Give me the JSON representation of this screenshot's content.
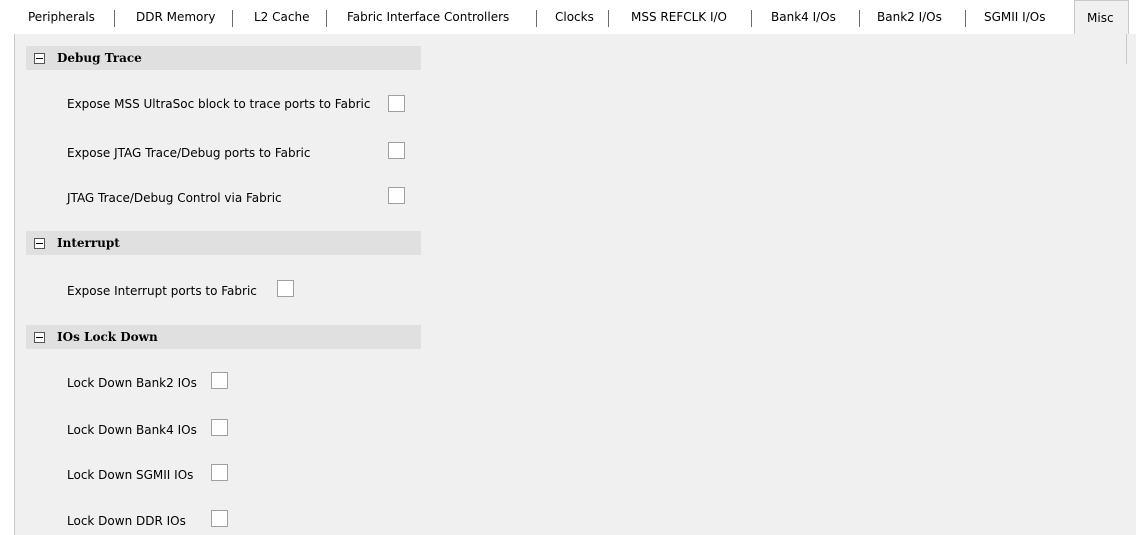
{
  "tabs": [
    {
      "label": "Peripherals"
    },
    {
      "label": "DDR Memory"
    },
    {
      "label": "L2 Cache"
    },
    {
      "label": "Fabric Interface Controllers"
    },
    {
      "label": "Clocks"
    },
    {
      "label": "MSS REFCLK I/O"
    },
    {
      "label": "Bank4 I/Os"
    },
    {
      "label": "Bank2 I/Os"
    },
    {
      "label": "SGMII I/Os"
    },
    {
      "label": "Misc"
    }
  ],
  "active_tab": "Misc",
  "sections": [
    {
      "title": "Debug Trace",
      "options": [
        {
          "label": "Expose MSS UltraSoc block to trace ports to Fabric",
          "checked": false
        },
        {
          "label": "Expose JTAG Trace/Debug ports to Fabric",
          "checked": false
        },
        {
          "label": "JTAG Trace/Debug Control via Fabric",
          "checked": false
        }
      ]
    },
    {
      "title": "Interrupt",
      "options": [
        {
          "label": "Expose Interrupt ports to Fabric",
          "checked": false
        }
      ]
    },
    {
      "title": "IOs Lock Down",
      "options": [
        {
          "label": "Lock Down Bank2 IOs",
          "checked": false
        },
        {
          "label": "Lock Down Bank4 IOs",
          "checked": false
        },
        {
          "label": "Lock Down SGMII IOs",
          "checked": false
        },
        {
          "label": "Lock Down DDR IOs",
          "checked": false
        }
      ]
    }
  ]
}
